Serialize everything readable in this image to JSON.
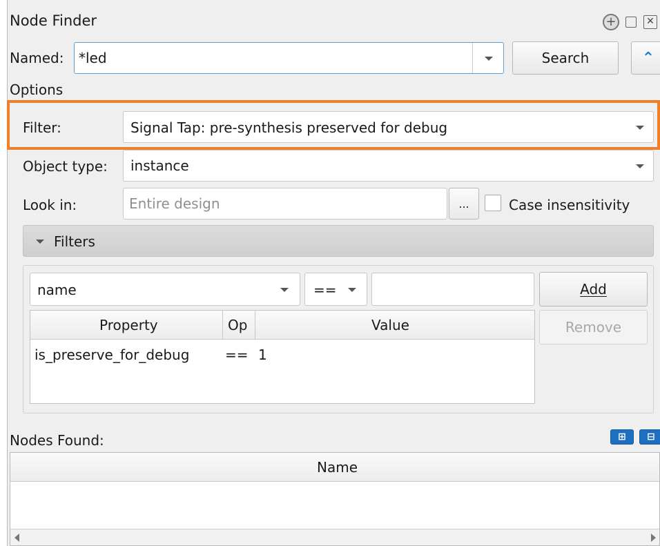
{
  "title": "Node Finder",
  "title_icons": [
    "add-circle-icon",
    "float-window-icon",
    "close-icon"
  ],
  "named": {
    "label": "Named:",
    "value": "*led",
    "search_label": "Search",
    "collapse_icon": "double-chevron-up-icon"
  },
  "options_label": "Options",
  "filter": {
    "label": "Filter:",
    "value": "Signal Tap: pre-synthesis preserved for debug",
    "highlight_color": "#f07f2a"
  },
  "object_type": {
    "label": "Object type:",
    "value": "instance"
  },
  "look_in": {
    "label": "Look in:",
    "placeholder": "Entire design",
    "browse_label": "...",
    "case_label": "Case insensitivity"
  },
  "filters_section": {
    "label": "Filters"
  },
  "filter_row": {
    "property": "name",
    "op": "==",
    "value": "",
    "add_label": "Add",
    "remove_label": "Remove"
  },
  "filter_table": {
    "headers": [
      "Property",
      "Op",
      "Value"
    ],
    "rows": [
      [
        "is_preserve_for_debug",
        "==",
        "1"
      ]
    ]
  },
  "nodes_found": {
    "label": "Nodes Found:",
    "column": "Name",
    "expand_icon": "expand-all-icon",
    "collapse_icon": "collapse-all-icon"
  }
}
